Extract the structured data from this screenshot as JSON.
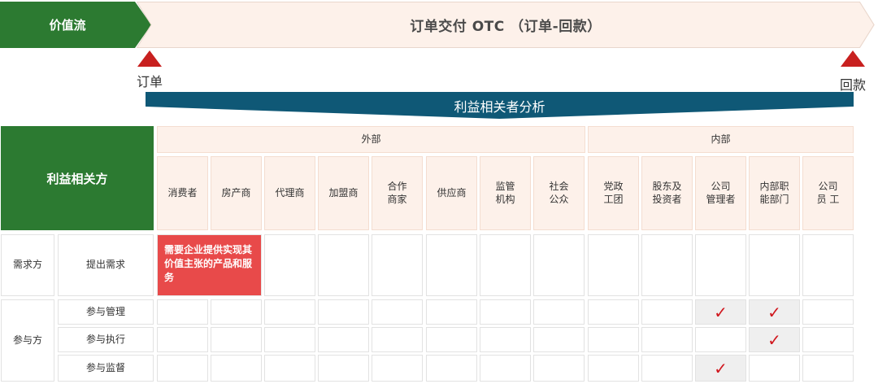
{
  "value_stream": {
    "label": "价值流",
    "process": "订单交付 OTC （订单-回款）",
    "start_marker": "订单",
    "end_marker": "回款"
  },
  "analysis_title": "利益相关者分析",
  "table": {
    "corner_header": "利益相关方",
    "groups": {
      "external": "外部",
      "internal": "内部"
    },
    "stakeholders": [
      "消费者",
      "房产商",
      "代理商",
      "加盟商",
      "合作\n商家",
      "供应商",
      "监管\n机构",
      "社会\n公众",
      "党政\n工团",
      "股东及\n投资者",
      "公司\n管理者",
      "内部职\n能部门",
      "公司\n员 工"
    ],
    "demand_side": {
      "role": "需求方",
      "activity": "提出需求",
      "note": "需要企业提供实现其价值主张的产品和服务"
    },
    "participant_side": {
      "role": "参与方",
      "activities": [
        "参与管理",
        "参与执行",
        "参与监督"
      ]
    },
    "check_mark": "✓",
    "checks": {
      "参与管理": [
        "公司管理者",
        "内部职能部门"
      ],
      "参与执行": [
        "内部职能部门"
      ],
      "参与监督": [
        "公司管理者"
      ]
    }
  },
  "colors": {
    "green": "#2c7a31",
    "navy": "#0f5876",
    "red": "#e84a4a",
    "marker": "#c8201f",
    "peach": "#fdf1ea"
  }
}
